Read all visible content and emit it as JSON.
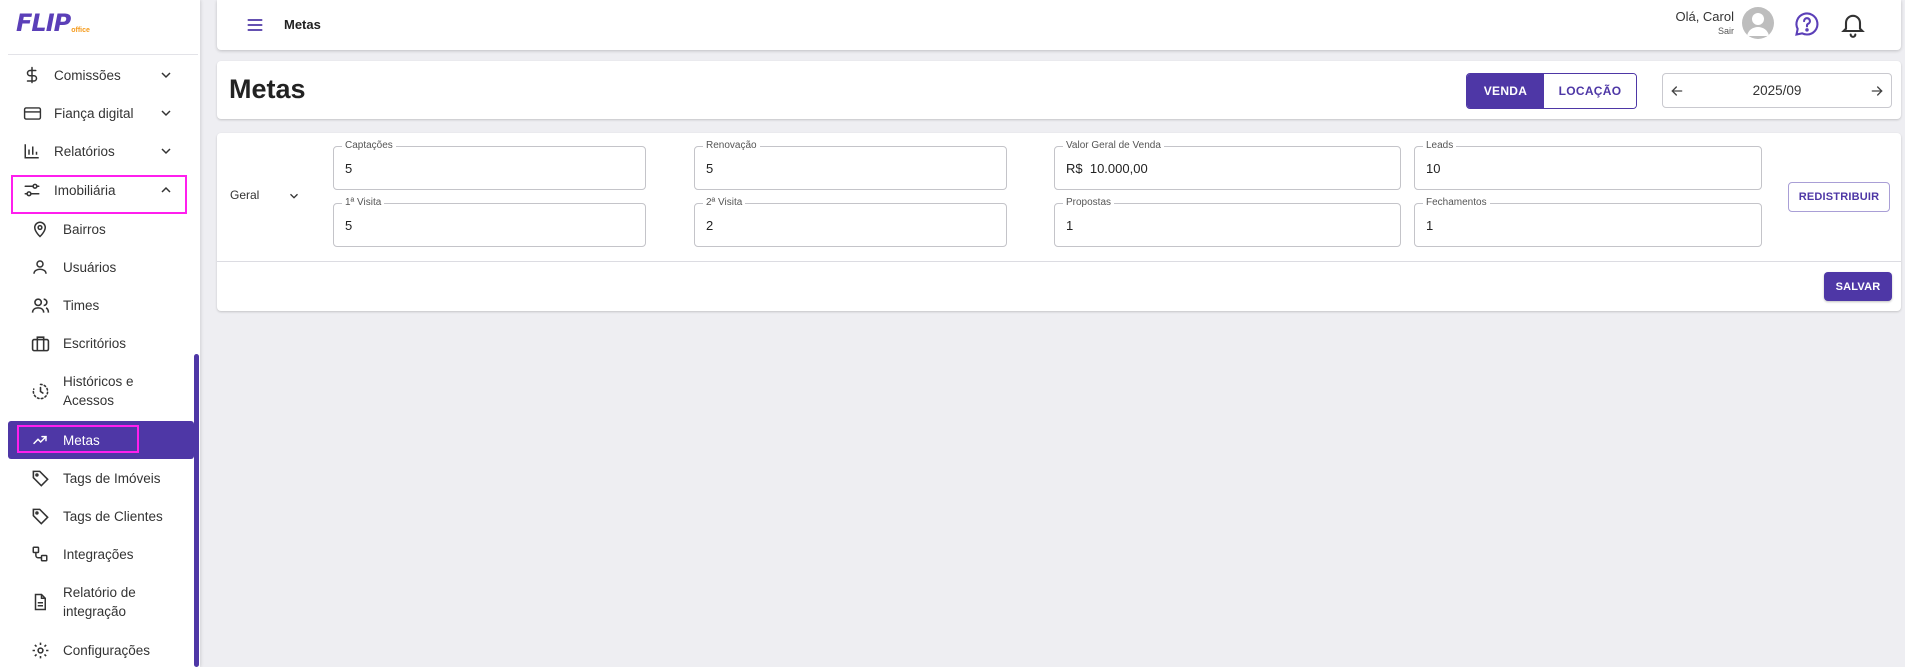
{
  "app": {
    "logo_text": "FLIP",
    "logo_sub": "office"
  },
  "sidebar": {
    "groups": [
      {
        "label": "Comissões",
        "icon": "dollar-icon"
      },
      {
        "label": "Fiança digital",
        "icon": "credit-card-icon"
      },
      {
        "label": "Relatórios",
        "icon": "bar-chart-icon"
      },
      {
        "label": "Imobiliária",
        "icon": "sliders-icon",
        "expanded": true
      }
    ],
    "items": [
      {
        "label": "Bairros",
        "icon": "map-pin-icon"
      },
      {
        "label": "Usuários",
        "icon": "user-icon"
      },
      {
        "label": "Times",
        "icon": "users-icon"
      },
      {
        "label": "Escritórios",
        "icon": "briefcase-icon"
      },
      {
        "label": "Históricos e Acessos",
        "icon": "history-icon"
      },
      {
        "label": "Metas",
        "icon": "trending-up-icon",
        "active": true
      },
      {
        "label": "Tags de Imóveis",
        "icon": "tag-icon"
      },
      {
        "label": "Tags de Clientes",
        "icon": "tag-icon"
      },
      {
        "label": "Integrações",
        "icon": "integration-icon"
      },
      {
        "label": "Relatório de integração",
        "icon": "file-text-icon"
      },
      {
        "label": "Configurações",
        "icon": "gear-icon"
      }
    ]
  },
  "topbar": {
    "page": "Metas",
    "greeting": "Olá, Carol",
    "logout": "Sair"
  },
  "header": {
    "title": "Metas",
    "toggle": {
      "active": "VENDA",
      "inactive": "LOCAÇÃO"
    },
    "period": "2025/09"
  },
  "form": {
    "scope": "Geral",
    "fields": [
      {
        "label": "Captações",
        "value": "5"
      },
      {
        "label": "Renovação",
        "value": "5"
      },
      {
        "label": "Valor Geral de Venda",
        "value": "R$  10.000,00"
      },
      {
        "label": "Leads",
        "value": "10"
      },
      {
        "label": "1ª Visita",
        "value": "5"
      },
      {
        "label": "2ª Visita",
        "value": "2"
      },
      {
        "label": "Propostas",
        "value": "1"
      },
      {
        "label": "Fechamentos",
        "value": "1"
      }
    ],
    "redistribute": "REDISTRIBUIR",
    "save": "SALVAR"
  },
  "colors": {
    "accent": "#4e37a6",
    "highlight": "#ff1fee",
    "logo_orange": "#f59a1a"
  }
}
